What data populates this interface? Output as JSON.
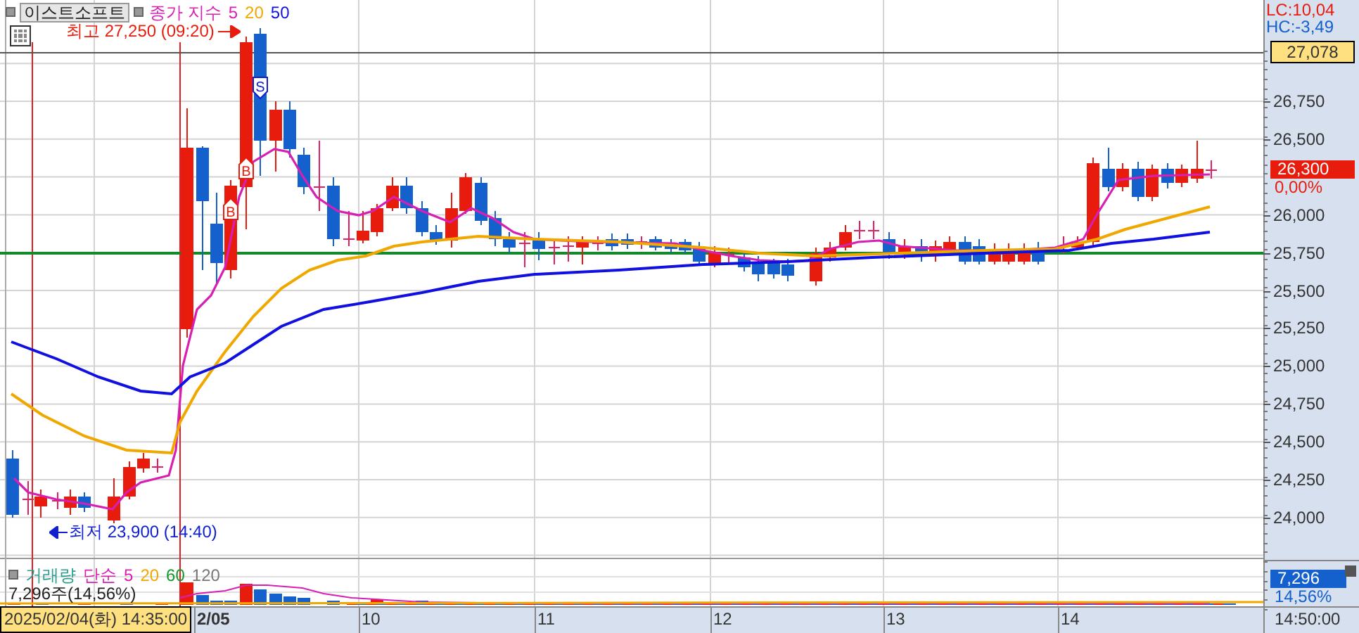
{
  "legend": {
    "symbol_button": "이스트소프트",
    "indicator": "종가 지수",
    "ma_periods": [
      {
        "label": "5",
        "color": "#d81fb4"
      },
      {
        "label": "20",
        "color": "#f0a800"
      },
      {
        "label": "50",
        "color": "#1010e0"
      }
    ]
  },
  "price_chart": {
    "high_annotation": "최고 27,250 (09:20)",
    "low_annotation": "최저 23,900 (14:40)",
    "signals": [
      {
        "kind": "buy",
        "label": "B"
      },
      {
        "kind": "buy",
        "label": "B"
      },
      {
        "kind": "sell",
        "label": "S"
      }
    ]
  },
  "price_axis": {
    "lc": "LC:10,04",
    "hc": "HC:-3,49",
    "reference_price": "27,078",
    "current_price": "26,300",
    "change": "0,00%",
    "ticks": [
      "26,750",
      "26,500",
      "26,000",
      "25,750",
      "25,500",
      "25,250",
      "25,000",
      "24,750",
      "24,500",
      "24,250",
      "24,000"
    ]
  },
  "volume_panel": {
    "title": "거래량",
    "ma_type": "단순",
    "ma_periods": [
      {
        "label": "5",
        "color": "#d81fb4"
      },
      {
        "label": "20",
        "color": "#f0a800"
      },
      {
        "label": "60",
        "color": "#129a2a"
      },
      {
        "label": "120",
        "color": "#777777"
      }
    ],
    "current": "7,296주(14,56%)"
  },
  "volume_axis": {
    "value": "7,296",
    "percent": "14,56%"
  },
  "time_axis": {
    "cursor_time": "2025/02/04(화) 14:35:00",
    "dates": [
      "2/05",
      "10",
      "11",
      "12",
      "13",
      "14"
    ],
    "last_time": "14:50:00"
  }
}
